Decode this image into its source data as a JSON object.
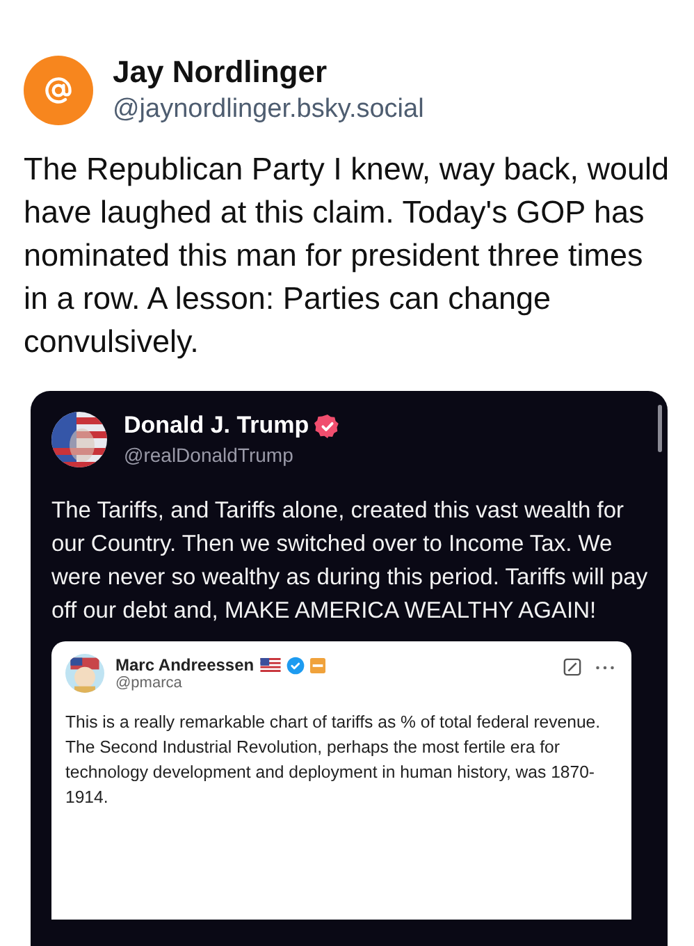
{
  "post": {
    "author": {
      "name": "Jay Nordlinger",
      "handle": "@jaynordlinger.bsky.social"
    },
    "text": "The Republican Party I knew, way back, would have laughed at this claim. Today's GOP has nominated this man for president three times in a row. A lesson: Parties can change convulsively.",
    "quote": {
      "author": {
        "name": "Donald J. Trump",
        "handle": "@realDonaldTrump",
        "verified": true
      },
      "text": "The Tariffs, and Tariffs alone, created this vast wealth for our Country. Then we switched over to Income Tax. We were never so wealthy as during this period. Tariffs will pay off our debt and, MAKE AMERICA WEALTHY AGAIN!",
      "quote": {
        "author": {
          "name": "Marc Andreessen",
          "handle": "@pmarca",
          "verified": true
        },
        "text": "This is a really remarkable chart of tariffs as % of total federal revenue. The Second Industrial Revolution, perhaps the most fertile era for technology development and deployment in human history, was 1870-1914."
      }
    }
  }
}
